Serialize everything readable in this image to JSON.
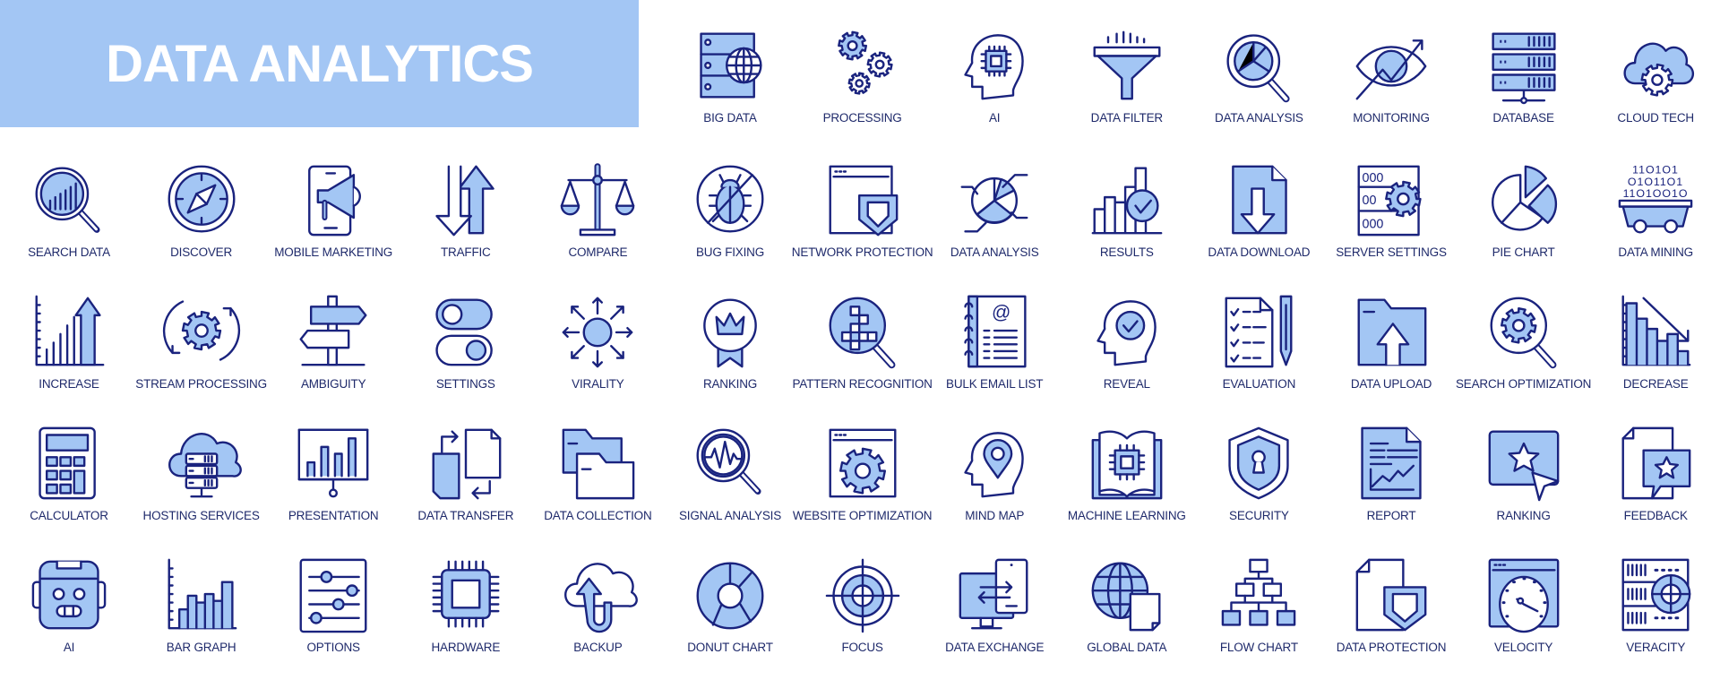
{
  "title": "DATA ANALYTICS",
  "colors": {
    "banner": "#a3c6f4",
    "title_text": "#ffffff",
    "stroke": "#1a237e",
    "fill": "#a3c6f4",
    "label": "#1f2a6b"
  },
  "icons": [
    {
      "label": "BIG DATA",
      "icon": "server-globe-icon"
    },
    {
      "label": "PROCESSING",
      "icon": "gears-icon"
    },
    {
      "label": "AI",
      "icon": "head-chip-icon"
    },
    {
      "label": "DATA FILTER",
      "icon": "funnel-icon"
    },
    {
      "label": "DATA ANALYSIS",
      "icon": "magnifier-pie-icon"
    },
    {
      "label": "MONITORING",
      "icon": "eye-trend-icon"
    },
    {
      "label": "DATABASE",
      "icon": "database-rack-icon"
    },
    {
      "label": "CLOUD TECH",
      "icon": "cloud-gear-icon"
    },
    {
      "label": "SEARCH DATA",
      "icon": "magnifier-bars-icon"
    },
    {
      "label": "DISCOVER",
      "icon": "compass-icon"
    },
    {
      "label": "MOBILE MARKETING",
      "icon": "phone-megaphone-icon"
    },
    {
      "label": "TRAFFIC",
      "icon": "up-down-arrows-icon"
    },
    {
      "label": "COMPARE",
      "icon": "scales-icon"
    },
    {
      "label": "BUG FIXING",
      "icon": "bug-crossed-icon"
    },
    {
      "label": "NETWORK PROTECTION",
      "icon": "window-shield-icon"
    },
    {
      "label": "DATA ANALYSIS",
      "icon": "pie-callout-icon"
    },
    {
      "label": "RESULTS",
      "icon": "bars-check-icon"
    },
    {
      "label": "DATA DOWNLOAD",
      "icon": "file-download-icon"
    },
    {
      "label": "SERVER SETTINGS",
      "icon": "server-gear-icon"
    },
    {
      "label": "PIE CHART",
      "icon": "pie-chart-icon"
    },
    {
      "label": "DATA MINING",
      "icon": "mine-cart-binary-icon"
    },
    {
      "label": "INCREASE",
      "icon": "increase-chart-icon"
    },
    {
      "label": "STREAM PROCESSING",
      "icon": "gear-cycle-icon"
    },
    {
      "label": "AMBIGUITY",
      "icon": "signpost-icon"
    },
    {
      "label": "SETTINGS",
      "icon": "toggles-icon"
    },
    {
      "label": "VIRALITY",
      "icon": "burst-arrows-icon"
    },
    {
      "label": "RANKING",
      "icon": "crown-badge-icon"
    },
    {
      "label": "PATTERN RECOGNITION",
      "icon": "magnifier-pattern-icon"
    },
    {
      "label": "BULK EMAIL LIST",
      "icon": "email-notebook-icon"
    },
    {
      "label": "REVEAL",
      "icon": "head-check-icon"
    },
    {
      "label": "EVALUATION",
      "icon": "checklist-pencil-icon"
    },
    {
      "label": "DATA UPLOAD",
      "icon": "folder-upload-icon"
    },
    {
      "label": "SEARCH OPTIMIZATION",
      "icon": "magnifier-gear-icon"
    },
    {
      "label": "DECREASE",
      "icon": "decrease-chart-icon"
    },
    {
      "label": "CALCULATOR",
      "icon": "calculator-icon"
    },
    {
      "label": "HOSTING SERVICES",
      "icon": "cloud-server-icon"
    },
    {
      "label": "PRESENTATION",
      "icon": "presentation-board-icon"
    },
    {
      "label": "DATA TRANSFER",
      "icon": "files-transfer-icon"
    },
    {
      "label": "DATA COLLECTION",
      "icon": "folders-icon"
    },
    {
      "label": "SIGNAL ANALYSIS",
      "icon": "magnifier-wave-icon"
    },
    {
      "label": "WEBSITE OPTIMIZATION",
      "icon": "window-gear-icon"
    },
    {
      "label": "MIND MAP",
      "icon": "head-pin-icon"
    },
    {
      "label": "MACHINE LEARNING",
      "icon": "book-chip-icon"
    },
    {
      "label": "SECURITY",
      "icon": "shield-keyhole-icon"
    },
    {
      "label": "REPORT",
      "icon": "report-document-icon"
    },
    {
      "label": "RANKING",
      "icon": "star-cursor-icon"
    },
    {
      "label": "FEEDBACK",
      "icon": "file-star-bubble-icon"
    },
    {
      "label": "AI",
      "icon": "robot-head-icon"
    },
    {
      "label": "BAR GRAPH",
      "icon": "bar-graph-icon"
    },
    {
      "label": "OPTIONS",
      "icon": "sliders-icon"
    },
    {
      "label": "HARDWARE",
      "icon": "cpu-chip-icon"
    },
    {
      "label": "BACKUP",
      "icon": "cloud-backup-icon"
    },
    {
      "label": "DONUT CHART",
      "icon": "donut-chart-icon"
    },
    {
      "label": "FOCUS",
      "icon": "target-icon"
    },
    {
      "label": "DATA EXCHANGE",
      "icon": "monitor-tablet-icon"
    },
    {
      "label": "GLOBAL DATA",
      "icon": "globe-file-icon"
    },
    {
      "label": "FLOW CHART",
      "icon": "flowchart-icon"
    },
    {
      "label": "DATA PROTECTION",
      "icon": "file-shield-icon"
    },
    {
      "label": "VELOCITY",
      "icon": "speedometer-window-icon"
    },
    {
      "label": "VERACITY",
      "icon": "server-target-icon"
    }
  ]
}
